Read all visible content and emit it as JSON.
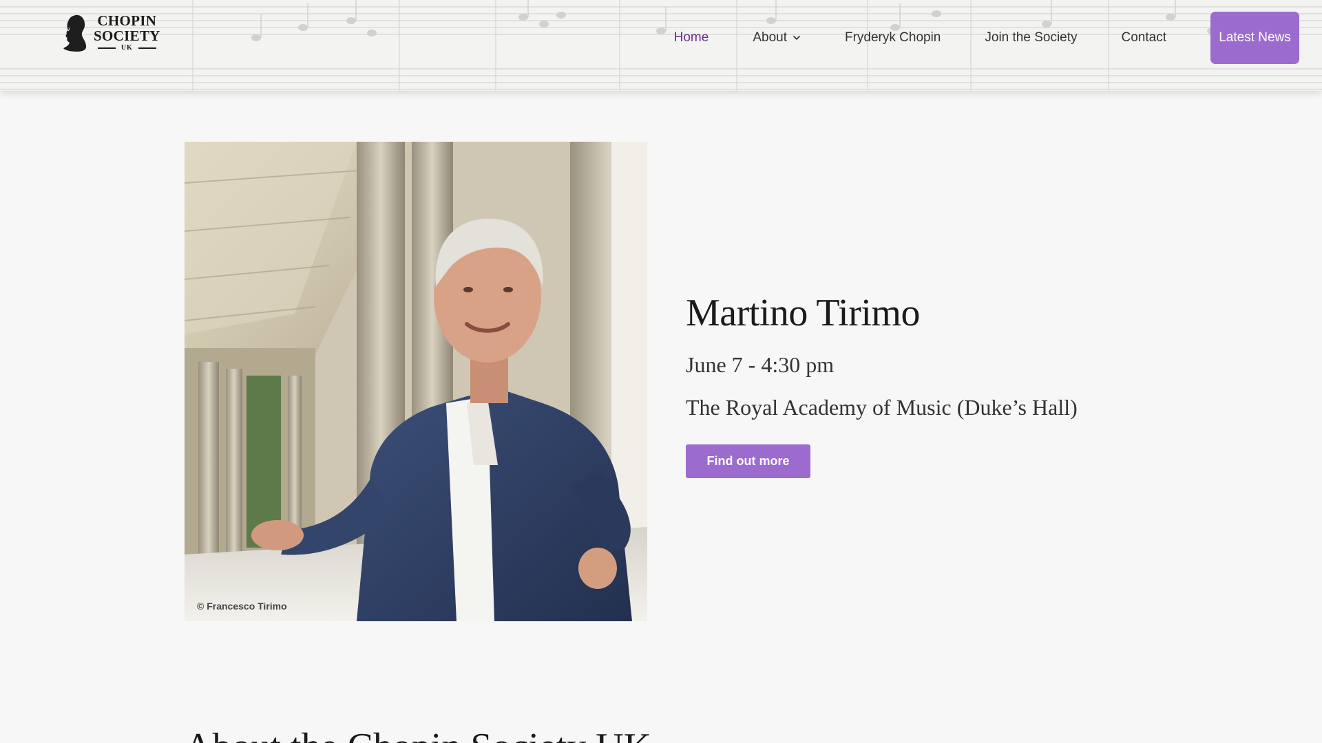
{
  "brand": {
    "line1": "CHOPIN",
    "line2": "SOCIETY",
    "line3": "UK"
  },
  "nav": {
    "items": [
      {
        "label": "Home",
        "active": true
      },
      {
        "label": "About",
        "has_dropdown": true
      },
      {
        "label": "Fryderyk Chopin"
      },
      {
        "label": "Join the Society"
      },
      {
        "label": "Contact"
      }
    ],
    "cta_label": "Latest News"
  },
  "hero": {
    "photo_credit": "© Francesco Tirimo",
    "title": "Martino Tirimo",
    "date": "June 7 - 4:30 pm",
    "venue": "The Royal Academy of Music (Duke’s Hall)",
    "button_label": "Find out more"
  },
  "about": {
    "heading": "About the Chopin Society UK"
  },
  "colors": {
    "accent": "#9c6bce",
    "active_nav": "#6b2c91",
    "page_bg": "#f7f7f7",
    "header_bg": "#f3f3f2"
  },
  "icons": {
    "logo": "chopin-bust-icon",
    "dropdown": "chevron-down-icon"
  }
}
